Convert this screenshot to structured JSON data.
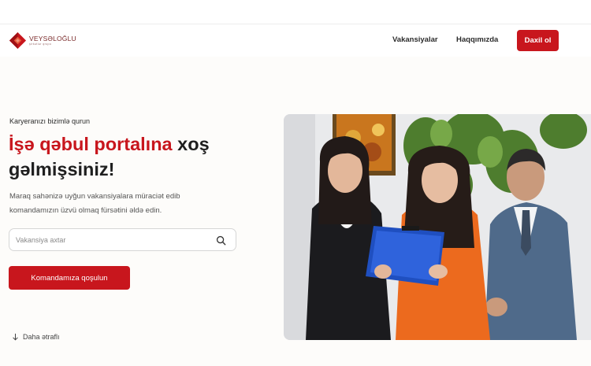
{
  "brand": {
    "name": "VEYSƏLOĞLU",
    "tagline": "şirkətlər qrupu",
    "color": "#c8161d"
  },
  "nav": {
    "items": [
      {
        "label": "Vakansiyalar"
      },
      {
        "label": "Haqqımızda"
      }
    ],
    "login_label": "Daxil ol"
  },
  "hero": {
    "eyebrow": "Karyeranızı bizimlə qurun",
    "title_accent": "İşə qəbul portalına",
    "title_rest_1": " xoş",
    "title_rest_2": "gəlmişsiniz!",
    "description": "Maraq sahənizə uyğun vakansiyalara müraciət edib komandamızın üzvü olmaq fürsətini əldə edin.",
    "search": {
      "placeholder": "Vakansiya axtar",
      "value": ""
    },
    "cta_label": "Komandamıza qoşulun",
    "more_label": "Daha ətraflı"
  },
  "icons": {
    "logo": "diamond-logo-icon",
    "search": "search-icon",
    "more": "arrow-down-icon"
  },
  "colors": {
    "accent": "#c8161d",
    "text": "#1f1f1f",
    "muted": "#555555",
    "blazer_orange": "#ec6a1e",
    "folder_blue": "#1f4fc0",
    "suit_blue": "#4f6a8a"
  }
}
